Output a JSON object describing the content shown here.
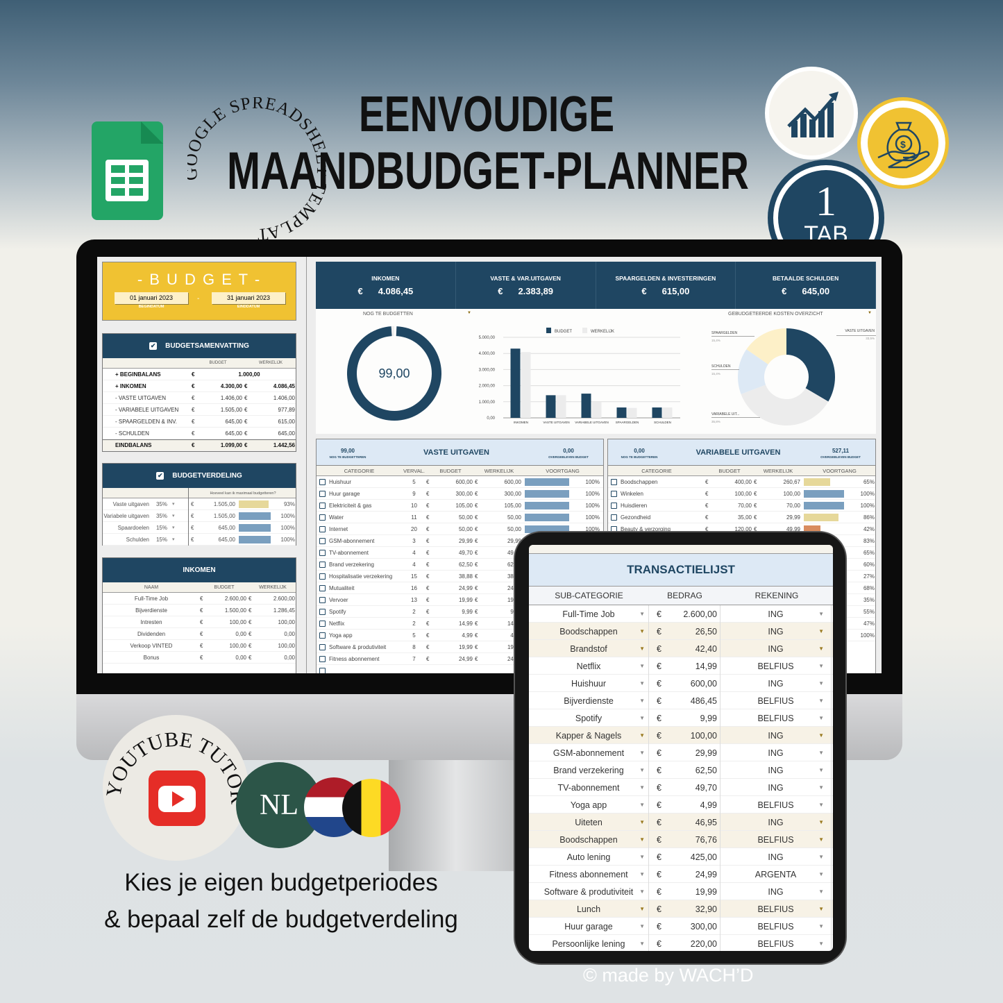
{
  "header": {
    "title_line1": "EENVOUDIGE",
    "title_line2": "MAANDBUDGET-PLANNER",
    "circle_text": "GOOGLE SPREADSHEET TEMPLATE"
  },
  "badges": {
    "tab_number": "1",
    "tab_label": "TAB",
    "chart_icon": "growth-chart-icon",
    "money_icon": "money-bag-hand-icon",
    "sheets_icon": "google-sheets-icon"
  },
  "promo": {
    "youtube_text": "YOUTUBE TUTORIAL",
    "language": "NL",
    "flags": [
      "netherlands-flag",
      "belgium-flag"
    ],
    "line1": "Kies je eigen budgetperiodes",
    "line2": "& bepaal zelf de budgetverdeling",
    "credit": "© made by WACH’D"
  },
  "colors": {
    "navy": "#1f4662",
    "yellow": "#f0c232",
    "bar_full": "#7a9fbf",
    "bar_partial": "#e6d89a",
    "bar_low": "#d98c5f",
    "light_blue": "#dde9f5"
  },
  "budget": {
    "title": "- B U D G E T -",
    "start_date": "01 januari 2023",
    "start_label": "BEGINDATUM",
    "separator": "-",
    "end_date": "31 januari 2023",
    "end_label": "EINDDATUM"
  },
  "summary": {
    "title": "BUDGETSAMENVATTING",
    "col_budget": "BUDGET",
    "col_actual": "WERKELIJK",
    "rows": [
      {
        "label": "+ BEGINBALANS",
        "bold": true,
        "cur": "€",
        "budget": "1.000,00",
        "cur2": "",
        "actual": ""
      },
      {
        "label": "+ INKOMEN",
        "bold": true,
        "cur": "€",
        "budget": "4.300,00",
        "cur2": "€",
        "actual": "4.086,45"
      },
      {
        "label": "- VASTE UITGAVEN",
        "cur": "€",
        "budget": "1.406,00",
        "cur2": "€",
        "actual": "1.406,00"
      },
      {
        "label": "- VARIABELE UITGAVEN",
        "cur": "€",
        "budget": "1.505,00",
        "cur2": "€",
        "actual": "977,89"
      },
      {
        "label": "- SPAARGELDEN & INV.",
        "cur": "€",
        "budget": "645,00",
        "cur2": "€",
        "actual": "615,00"
      },
      {
        "label": "- SCHULDEN",
        "cur": "€",
        "budget": "645,00",
        "cur2": "€",
        "actual": "645,00"
      },
      {
        "label": "EINDBALANS",
        "bold": true,
        "footer": true,
        "cur": "€",
        "budget": "1.099,00",
        "cur2": "€",
        "actual": "1.442,56"
      }
    ]
  },
  "distribution": {
    "title": "BUDGETVERDELING",
    "question": "Hoeveel kan ik maximaal budgetteren?",
    "rows": [
      {
        "label": "Vaste uitgaven",
        "pct": "35%",
        "cur": "€",
        "amount": "1.505,00",
        "progress": 93,
        "progress_label": "93%"
      },
      {
        "label": "Variabele uitgaven",
        "pct": "35%",
        "cur": "€",
        "amount": "1.505,00",
        "progress": 100,
        "progress_label": "100%"
      },
      {
        "label": "Spaardoelen",
        "pct": "15%",
        "cur": "€",
        "amount": "645,00",
        "progress": 100,
        "progress_label": "100%"
      },
      {
        "label": "Schulden",
        "pct": "15%",
        "cur": "€",
        "amount": "645,00",
        "progress": 100,
        "progress_label": "100%"
      }
    ]
  },
  "income": {
    "title": "INKOMEN",
    "col_name": "NAAM",
    "col_budget": "BUDGET",
    "col_actual": "WERKELIJK",
    "rows": [
      {
        "name": "Full-Time Job",
        "cur": "€",
        "budget": "2.600,00",
        "cur2": "€",
        "actual": "2.600,00"
      },
      {
        "name": "Bijverdienste",
        "cur": "€",
        "budget": "1.500,00",
        "cur2": "€",
        "actual": "1.286,45"
      },
      {
        "name": "Intresten",
        "cur": "€",
        "budget": "100,00",
        "cur2": "€",
        "actual": "100,00"
      },
      {
        "name": "Dividenden",
        "cur": "€",
        "budget": "0,00",
        "cur2": "€",
        "actual": "0,00"
      },
      {
        "name": "Verkoop VINTED",
        "cur": "€",
        "budget": "100,00",
        "cur2": "€",
        "actual": "100,00"
      },
      {
        "name": "Bonus",
        "cur": "€",
        "budget": "0,00",
        "cur2": "€",
        "actual": "0,00"
      }
    ]
  },
  "kpis": [
    {
      "label": "INKOMEN",
      "cur": "€",
      "value": "4.086,45"
    },
    {
      "label": "VASTE & VAR.UITGAVEN",
      "cur": "€",
      "value": "2.383,89"
    },
    {
      "label": "SPAARGELDEN & INVESTERINGEN",
      "cur": "€",
      "value": "615,00"
    },
    {
      "label": "BETAALDE SCHULDEN",
      "cur": "€",
      "value": "645,00"
    }
  ],
  "chart_data": [
    {
      "type": "pie",
      "title": "NOG TE BUDGETTEN",
      "center_label": "99,00",
      "values": [
        99,
        1
      ]
    },
    {
      "type": "bar",
      "categories": [
        "INKOMEN",
        "VASTE UITGAVEN",
        "VARIABELE UITGAVEN",
        "SPAARGELDEN",
        "SCHULDEN"
      ],
      "series": [
        {
          "name": "BUDGET",
          "values": [
            4300,
            1406,
            1505,
            645,
            645
          ],
          "color": "#1f4662"
        },
        {
          "name": "WERKELIJK",
          "values": [
            4086.45,
            1406,
            977.89,
            615,
            645
          ],
          "color": "#ececec"
        }
      ],
      "ylim": [
        0,
        5000
      ],
      "yticks": [
        "0,00",
        "1.000,00",
        "2.000,00",
        "3.000,00",
        "4.000,00",
        "5.000,00"
      ],
      "grid": true,
      "legend": "top"
    },
    {
      "type": "pie",
      "title": "GEBUDGETEERDE KOSTEN OVERZICHT",
      "donut": true,
      "slices": [
        {
          "label": "VASTE UITGAVEN",
          "pct_label": "33,5%",
          "value": 33.5,
          "color": "#1f4662"
        },
        {
          "label": "VARIABELE UIT...",
          "pct_label": "35,8%",
          "value": 35.8,
          "color": "#ececec"
        },
        {
          "label": "SCHULDEN",
          "pct_label": "15,4%",
          "value": 15.4,
          "color": "#dde9f5"
        },
        {
          "label": "SPAARGELDEN",
          "pct_label": "15,4%",
          "value": 15.4,
          "color": "#fdf0c8"
        }
      ]
    }
  ],
  "fixed": {
    "title": "VASTE UITGAVEN",
    "left_value": "99,00",
    "left_label": "NOG TE BUDGETTEREN",
    "right_value": "0,00",
    "right_label": "OVERGEBLEVEN BUDGET",
    "cols": [
      "CATEGORIE",
      "VERVAL.",
      "BUDGET",
      "WERKELIJK",
      "VOORTGANG"
    ],
    "rows": [
      {
        "name": "Huishuur",
        "due": "5",
        "budget": "600,00",
        "actual": "600,00",
        "pct": 100
      },
      {
        "name": "Huur garage",
        "due": "9",
        "budget": "300,00",
        "actual": "300,00",
        "pct": 100
      },
      {
        "name": "Elektriciteit & gas",
        "due": "10",
        "budget": "105,00",
        "actual": "105,00",
        "pct": 100
      },
      {
        "name": "Water",
        "due": "11",
        "budget": "50,00",
        "actual": "50,00",
        "pct": 100
      },
      {
        "name": "Internet",
        "due": "20",
        "budget": "50,00",
        "actual": "50,00",
        "pct": 100
      },
      {
        "name": "GSM-abonnement",
        "due": "3",
        "budget": "29,99",
        "actual": "29,99"
      },
      {
        "name": "TV-abonnement",
        "due": "4",
        "budget": "49,70",
        "actual": "49,70"
      },
      {
        "name": "Brand verzekering",
        "due": "4",
        "budget": "62,50",
        "actual": "62,50"
      },
      {
        "name": "Hospitalisatie verzekering",
        "due": "15",
        "budget": "38,88",
        "actual": "38,88"
      },
      {
        "name": "Mutualiteit",
        "due": "16",
        "budget": "24,99",
        "actual": "24,99"
      },
      {
        "name": "Vervoer",
        "due": "13",
        "budget": "19,99",
        "actual": "19,99"
      },
      {
        "name": "Spotify",
        "due": "2",
        "budget": "9,99",
        "actual": "9,99"
      },
      {
        "name": "Netflix",
        "due": "2",
        "budget": "14,99",
        "actual": "14,99"
      },
      {
        "name": "Yoga app",
        "due": "5",
        "budget": "4,99",
        "actual": "4,99"
      },
      {
        "name": "Software & produtiviteit",
        "due": "8",
        "budget": "19,99",
        "actual": "19,99"
      },
      {
        "name": "Fitness abonnement",
        "due": "7",
        "budget": "24,99",
        "actual": "24,99"
      },
      {
        "name": "",
        "due": "",
        "budget": "",
        "actual": ""
      }
    ]
  },
  "variable": {
    "title": "VARIABELE UITGAVEN",
    "left_value": "0,00",
    "left_label": "NOG TE BUDGETTEREN",
    "right_value": "527,11",
    "right_label": "OVERGEBLEVEN BUDGET",
    "cols": [
      "CATEGORIE",
      "BUDGET",
      "WERKELIJK",
      "VOORTGANG"
    ],
    "rows": [
      {
        "name": "Boodschappen",
        "budget": "400,00",
        "actual": "260,67",
        "pct": 65
      },
      {
        "name": "Winkelen",
        "budget": "100,00",
        "actual": "100,00",
        "pct": 100
      },
      {
        "name": "Huisdieren",
        "budget": "70,00",
        "actual": "70,00",
        "pct": 100
      },
      {
        "name": "Gezondheid",
        "budget": "35,00",
        "actual": "29,99",
        "pct": 86
      },
      {
        "name": "Beauty & verzorging",
        "budget": "120,00",
        "actual": "49,99",
        "pct": 42
      },
      {
        "pct": 83
      },
      {
        "pct": 65
      },
      {
        "pct": 60
      },
      {
        "pct": 27
      },
      {
        "pct": 68
      },
      {
        "pct": 35
      },
      {
        "pct": 55
      },
      {
        "pct": 47
      },
      {
        "pct": 100
      }
    ]
  },
  "transactions": {
    "title": "TRANSACTIELIJST",
    "cols": [
      "SUB-CATEGORIE",
      "BEDRAG",
      "REKENING"
    ],
    "rows": [
      {
        "sub": "Full-Time Job",
        "amount": "2.600,00",
        "account": "ING"
      },
      {
        "sub": "Boodschappen",
        "amount": "26,50",
        "account": "ING",
        "hl": true
      },
      {
        "sub": "Brandstof",
        "amount": "42,40",
        "account": "ING",
        "hl": true
      },
      {
        "sub": "Netflix",
        "amount": "14,99",
        "account": "BELFIUS"
      },
      {
        "sub": "Huishuur",
        "amount": "600,00",
        "account": "ING"
      },
      {
        "sub": "Bijverdienste",
        "amount": "486,45",
        "account": "BELFIUS"
      },
      {
        "sub": "Spotify",
        "amount": "9,99",
        "account": "BELFIUS"
      },
      {
        "sub": "Kapper & Nagels",
        "amount": "100,00",
        "account": "ING",
        "hl": true
      },
      {
        "sub": "GSM-abonnement",
        "amount": "29,99",
        "account": "ING"
      },
      {
        "sub": "Brand verzekering",
        "amount": "62,50",
        "account": "ING"
      },
      {
        "sub": "TV-abonnement",
        "amount": "49,70",
        "account": "ING"
      },
      {
        "sub": "Yoga app",
        "amount": "4,99",
        "account": "BELFIUS"
      },
      {
        "sub": "Uiteten",
        "amount": "46,95",
        "account": "ING",
        "hl": true
      },
      {
        "sub": "Boodschappen",
        "amount": "76,76",
        "account": "BELFIUS",
        "hl": true
      },
      {
        "sub": "Auto lening",
        "amount": "425,00",
        "account": "ING"
      },
      {
        "sub": "Fitness abonnement",
        "amount": "24,99",
        "account": "ARGENTA"
      },
      {
        "sub": "Software & produtiviteit",
        "amount": "19,99",
        "account": "ING"
      },
      {
        "sub": "Lunch",
        "amount": "32,90",
        "account": "BELFIUS",
        "hl": true
      },
      {
        "sub": "Huur garage",
        "amount": "300,00",
        "account": "BELFIUS"
      },
      {
        "sub": "Persoonlijke lening",
        "amount": "220,00",
        "account": "BELFIUS"
      }
    ],
    "currency": "€"
  }
}
